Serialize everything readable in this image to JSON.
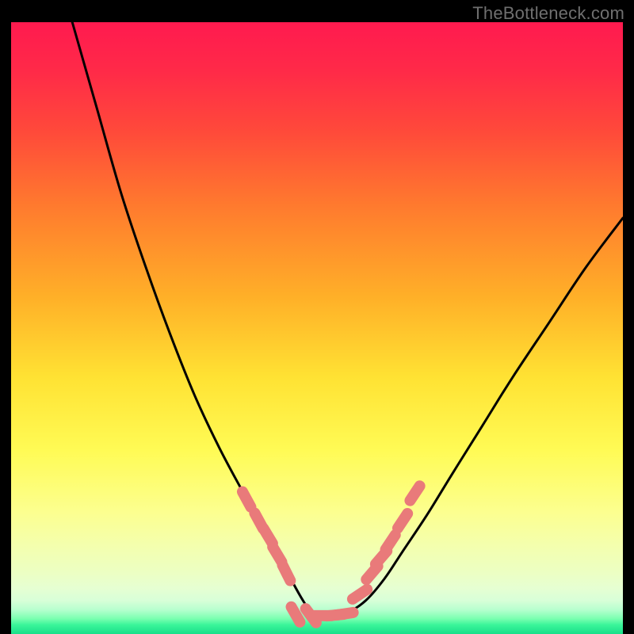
{
  "watermark": "TheBottleneck.com",
  "colors": {
    "curve": "#000000",
    "dots": "#e97a7a",
    "gradient_stops": [
      {
        "offset": 0.0,
        "color": "#ff1a4f"
      },
      {
        "offset": 0.08,
        "color": "#ff2a48"
      },
      {
        "offset": 0.18,
        "color": "#ff4a3a"
      },
      {
        "offset": 0.3,
        "color": "#ff7a2e"
      },
      {
        "offset": 0.45,
        "color": "#ffb028"
      },
      {
        "offset": 0.58,
        "color": "#ffe233"
      },
      {
        "offset": 0.7,
        "color": "#fffb55"
      },
      {
        "offset": 0.8,
        "color": "#fcff8f"
      },
      {
        "offset": 0.86,
        "color": "#f3ffb0"
      },
      {
        "offset": 0.9,
        "color": "#ecffc3"
      },
      {
        "offset": 0.925,
        "color": "#e6ffd2"
      },
      {
        "offset": 0.945,
        "color": "#d8ffd8"
      },
      {
        "offset": 0.96,
        "color": "#b8ffcf"
      },
      {
        "offset": 0.975,
        "color": "#7affb0"
      },
      {
        "offset": 0.985,
        "color": "#3bf59a"
      },
      {
        "offset": 1.0,
        "color": "#18df8a"
      }
    ]
  },
  "chart_data": {
    "type": "line",
    "title": "",
    "xlabel": "",
    "ylabel": "",
    "xlim": [
      0,
      100
    ],
    "ylim": [
      0,
      100
    ],
    "series": [
      {
        "name": "bottleneck-curve",
        "x": [
          10,
          14,
          18,
          22,
          26,
          30,
          34,
          38,
          41,
          44,
          46,
          48,
          49.5,
          51,
          53,
          55,
          58,
          61,
          64,
          68,
          72,
          77,
          82,
          88,
          94,
          100
        ],
        "y": [
          100,
          86,
          72,
          60,
          49,
          39,
          30.5,
          23,
          17.5,
          12.5,
          8.5,
          5,
          3,
          3,
          3.2,
          3.5,
          5.5,
          9,
          13.5,
          19.5,
          26,
          34,
          42,
          51,
          60,
          68
        ]
      }
    ],
    "markers": [
      {
        "name": "left-dots",
        "x": [
          38.5,
          40.5,
          42,
          43.5,
          45
        ],
        "y": [
          22,
          18.5,
          16,
          13,
          10
        ]
      },
      {
        "name": "floor-dots",
        "x": [
          46.5,
          49,
          51,
          53,
          54.5
        ],
        "y": [
          3.2,
          3.0,
          3.0,
          3.1,
          3.3
        ]
      },
      {
        "name": "right-dots",
        "x": [
          57,
          59,
          60.5,
          62,
          64,
          66
        ],
        "y": [
          6.5,
          10,
          12.5,
          15,
          18.5,
          23
        ]
      }
    ]
  }
}
